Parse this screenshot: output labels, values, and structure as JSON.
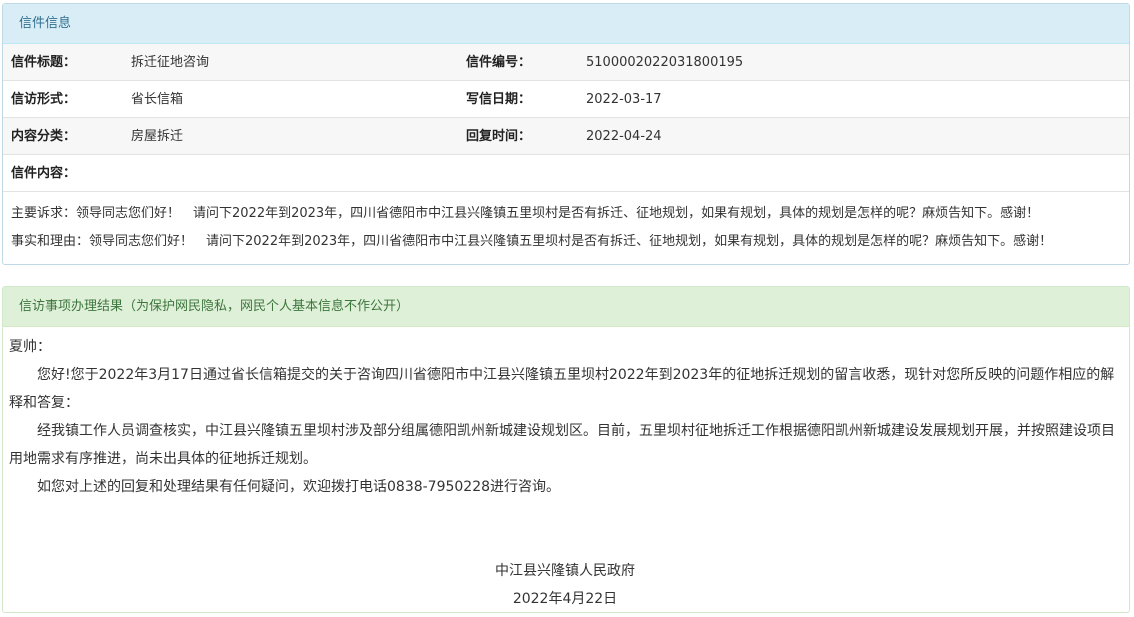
{
  "letter_info": {
    "title": "信件信息",
    "rows": [
      {
        "l1": "信件标题：",
        "v1": "拆迁征地咨询",
        "l2": "信件编号：",
        "v2": "510000202203180019​5"
      },
      {
        "l1": "信访形式：",
        "v1": "省长信箱",
        "l2": "写信日期：",
        "v2": "2022-03-17"
      },
      {
        "l1": "内容分类：",
        "v1": "房屋拆迁",
        "l2": "回复时间：",
        "v2": "2022-04-24"
      }
    ],
    "content_label": "信件内容：",
    "main_request": "主要诉求：领导同志您们好！　请问下2022年到2023年，四川省德阳市中江县兴隆镇五里坝村是否有拆迁、征地规划，如果有规划，具体的规划是怎样的呢？麻烦告知下。感谢！",
    "facts": "事实和理由：领导同志您们好！　请问下2022年到2023年，四川省德阳市中江县兴隆镇五里坝村是否有拆迁、征地规划，如果有规划，具体的规划是怎样的呢？麻烦告知下。感谢！"
  },
  "result": {
    "title": "信访事项办理结果（为保护网民隐私，网民个人基本信息不作公开）",
    "salutation": "夏帅：",
    "p1": "您好!您于2022年3月17日通过省长信箱提交的关于咨询四川省德阳市中江县兴隆镇五里坝村2022年到2023年的征地拆迁规划的留言收悉，现针对您所反映的问题作相应的解释和答复：",
    "p2": "经我镇工作人员调查核实，中江县兴隆镇五里坝村涉及部分组属德阳凯州新城建设规划区。目前，五里坝村征地拆迁工作根据德阳凯州新城建设发展规划开展，并按照建设项目用地需求有序推进，尚未出具体的征地拆迁规划。",
    "p3": "如您对上述的回复和处理结果有任何疑问，欢迎拨打电话0838-7950228进行咨询。",
    "signature": "中江县兴隆镇人民政府",
    "date": "2022年4月22日"
  }
}
